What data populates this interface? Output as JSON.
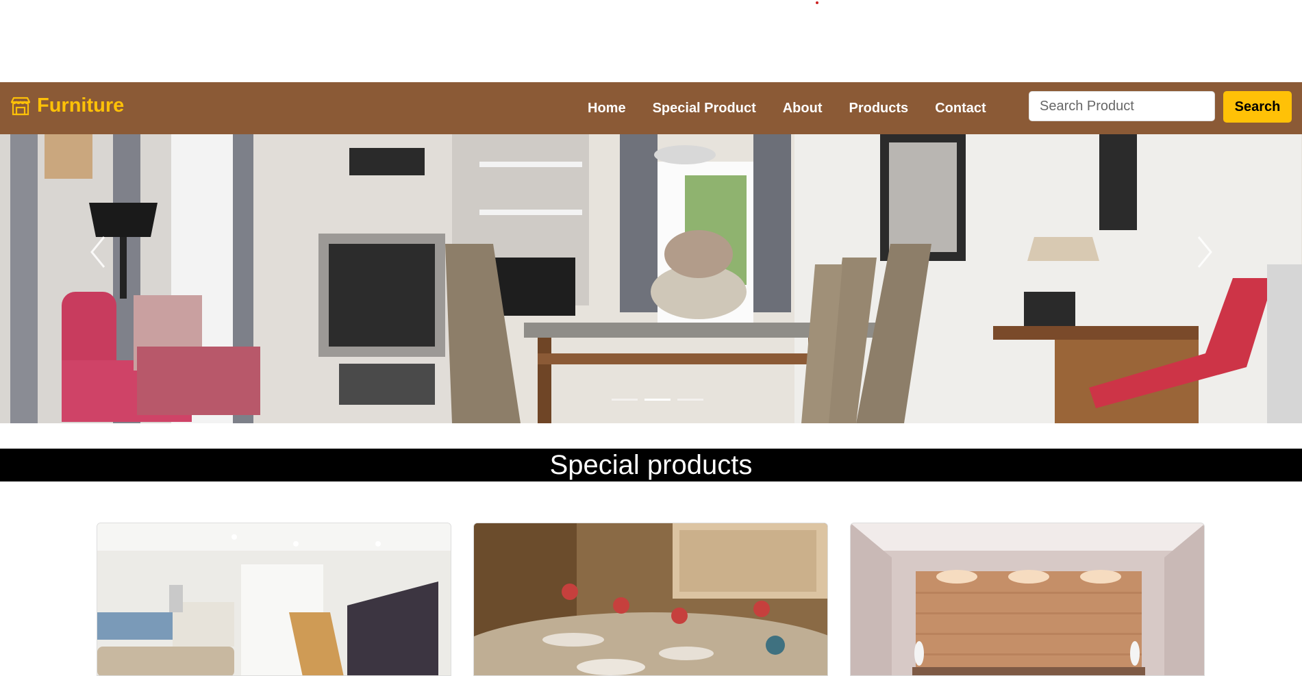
{
  "navbar": {
    "brand": "Furniture",
    "brand_icon": "store-icon",
    "links": [
      "Home",
      "Special Product",
      "About",
      "Products",
      "Contact"
    ],
    "search_placeholder": "Search Product",
    "search_button": "Search"
  },
  "carousel": {
    "prev_icon": "chevron-left-icon",
    "next_icon": "chevron-right-icon",
    "indicators": 3,
    "active_index": 1
  },
  "special": {
    "heading": "Special products"
  },
  "colors": {
    "navbar_bg": "#8b5a36",
    "accent": "#ffc107",
    "heading_bg": "#000000"
  }
}
